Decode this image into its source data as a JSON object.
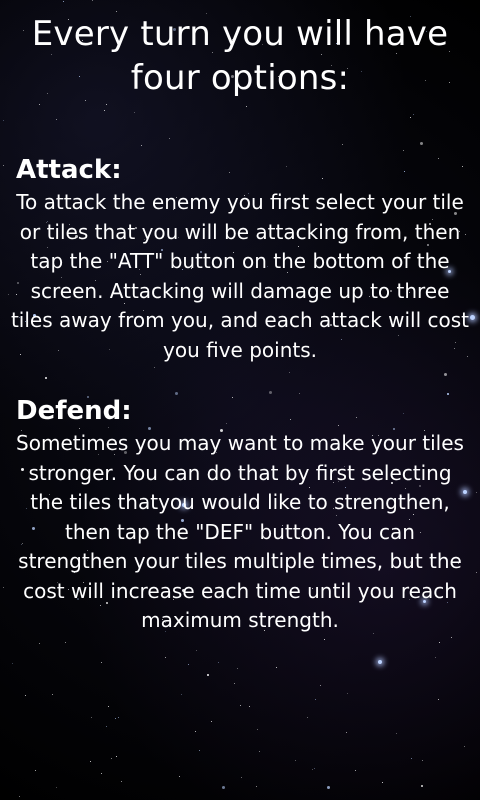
{
  "title": "Every turn you will have four options:",
  "sections": [
    {
      "heading": "Attack:",
      "body": "To attack the enemy you first select your tile or tiles that you will be attacking from, then tap the \"ATT\" button on the bottom of the screen. Attacking will damage up to three tiles away from you, and each attack will cost you five points."
    },
    {
      "heading": "Defend:",
      "body": "Sometimes you may want to make your tiles stronger. You can do that by first selecting the tiles thatyou would like to strengthen, then tap the \"DEF\" button. You can strengthen your tiles multiple times, but the cost will increase each time until you reach maximum strength."
    }
  ],
  "background": {
    "type": "starfield",
    "base_color": "#000000",
    "star_color": "#ffffff"
  }
}
